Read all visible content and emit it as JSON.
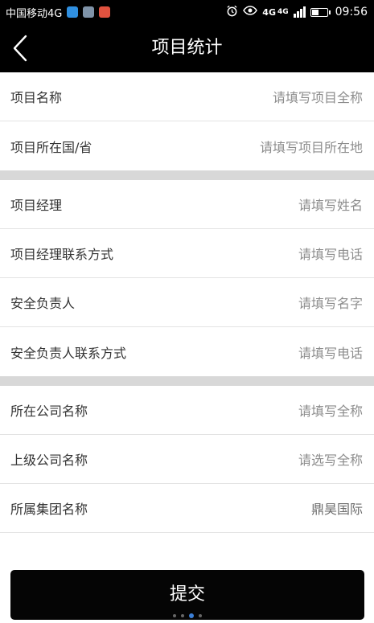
{
  "status_bar": {
    "carrier": "中国移动4G",
    "network": "4G",
    "network2": "4G",
    "time": "09:56"
  },
  "nav": {
    "title": "项目统计"
  },
  "form": {
    "group1": [
      {
        "label": "项目名称",
        "value": "请填写项目全称"
      },
      {
        "label": "项目所在国/省",
        "value": "请填写项目所在地"
      }
    ],
    "group2": [
      {
        "label": "项目经理",
        "value": "请填写姓名"
      },
      {
        "label": "项目经理联系方式",
        "value": "请填写电话"
      },
      {
        "label": "安全负责人",
        "value": "请填写名字"
      },
      {
        "label": "安全负责人联系方式",
        "value": "请填写电话"
      }
    ],
    "group3": [
      {
        "label": "所在公司名称",
        "value": "请填写全称"
      },
      {
        "label": "上级公司名称",
        "value": "请选写全称"
      },
      {
        "label": "所属集团名称",
        "value": "鼎昊国际"
      }
    ]
  },
  "submit": {
    "label": "提交"
  }
}
